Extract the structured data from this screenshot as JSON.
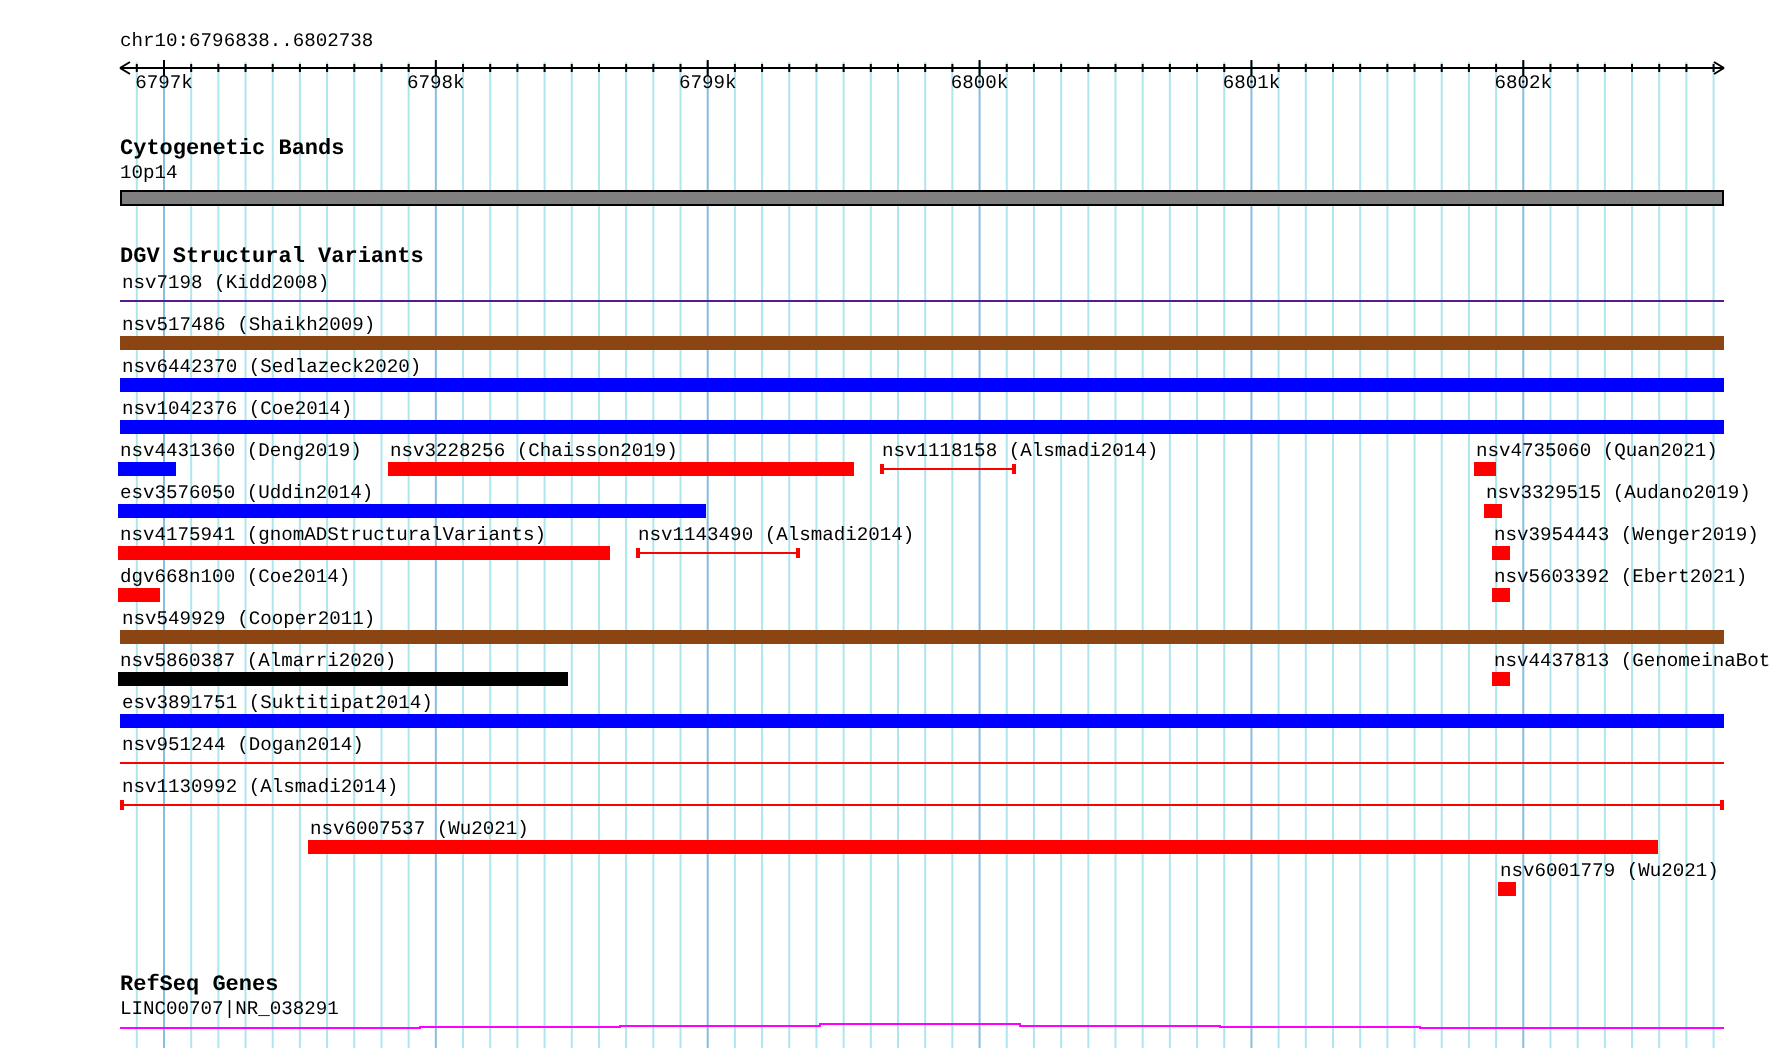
{
  "region": "chr10:6796838..6802738",
  "ruler_ticks": [
    "6797k",
    "6798k",
    "6799k",
    "6800k",
    "6801k",
    "6802k"
  ],
  "tracks": [
    {
      "kind": "cytoband",
      "title": "Cytogenetic Bands",
      "items": [
        {
          "label": "10p14"
        }
      ]
    },
    {
      "kind": "variants",
      "title": "DGV Structural Variants",
      "features": [
        {
          "label": "nsv7198 (Kidd2008)",
          "kind": "line",
          "color": "#551a8b"
        },
        {
          "label": "nsv517486 (Shaikh2009)",
          "kind": "bar",
          "color": "#8b4513"
        },
        {
          "label": "nsv6442370 (Sedlazeck2020)",
          "kind": "bar",
          "color": "#0000ff"
        },
        {
          "label": "nsv1042376 (Coe2014)",
          "kind": "bar",
          "color": "#0000ff"
        },
        {
          "label": "nsv4431360 (Deng2019)",
          "kind": "bar",
          "color": "#0000ff"
        },
        {
          "label": "nsv3228256 (Chaisson2019)",
          "kind": "bar",
          "color": "#ff0000"
        },
        {
          "label": "nsv1118158 (Alsmadi2014)",
          "kind": "interval",
          "color": "#ff0000"
        },
        {
          "label": "nsv4735060 (Quan2021)",
          "kind": "bar",
          "color": "#ff0000"
        },
        {
          "label": "esv3576050 (Uddin2014)",
          "kind": "bar",
          "color": "#0000ff"
        },
        {
          "label": "nsv3329515 (Audano2019)",
          "kind": "bar",
          "color": "#ff0000"
        },
        {
          "label": "nsv4175941 (gnomADStructuralVariants)",
          "kind": "bar",
          "color": "#ff0000"
        },
        {
          "label": "nsv1143490 (Alsmadi2014)",
          "kind": "interval",
          "color": "#ff0000"
        },
        {
          "label": "nsv3954443 (Wenger2019)",
          "kind": "bar",
          "color": "#ff0000"
        },
        {
          "label": "dgv668n100 (Coe2014)",
          "kind": "bar",
          "color": "#ff0000"
        },
        {
          "label": "nsv5603392 (Ebert2021)",
          "kind": "bar",
          "color": "#ff0000"
        },
        {
          "label": "nsv549929 (Cooper2011)",
          "kind": "bar",
          "color": "#8b4513"
        },
        {
          "label": "nsv5860387 (Almarri2020)",
          "kind": "bar",
          "color": "#000000"
        },
        {
          "label": "nsv4437813 (GenomeinaBot",
          "kind": "bar",
          "color": "#ff0000"
        },
        {
          "label": "esv3891751 (Suktitipat2014)",
          "kind": "bar",
          "color": "#0000ff"
        },
        {
          "label": "nsv951244 (Dogan2014)",
          "kind": "line",
          "color": "#ff0000"
        },
        {
          "label": "nsv1130992 (Alsmadi2014)",
          "kind": "interval",
          "color": "#ff0000"
        },
        {
          "label": "nsv6007537 (Wu2021)",
          "kind": "bar",
          "color": "#ff0000"
        },
        {
          "label": "nsv6001779 (Wu2021)",
          "kind": "bar",
          "color": "#ff0000"
        }
      ]
    },
    {
      "kind": "genes",
      "title": "RefSeq Genes",
      "items": [
        {
          "label": "LINC00707|NR_038291"
        }
      ]
    }
  ]
}
